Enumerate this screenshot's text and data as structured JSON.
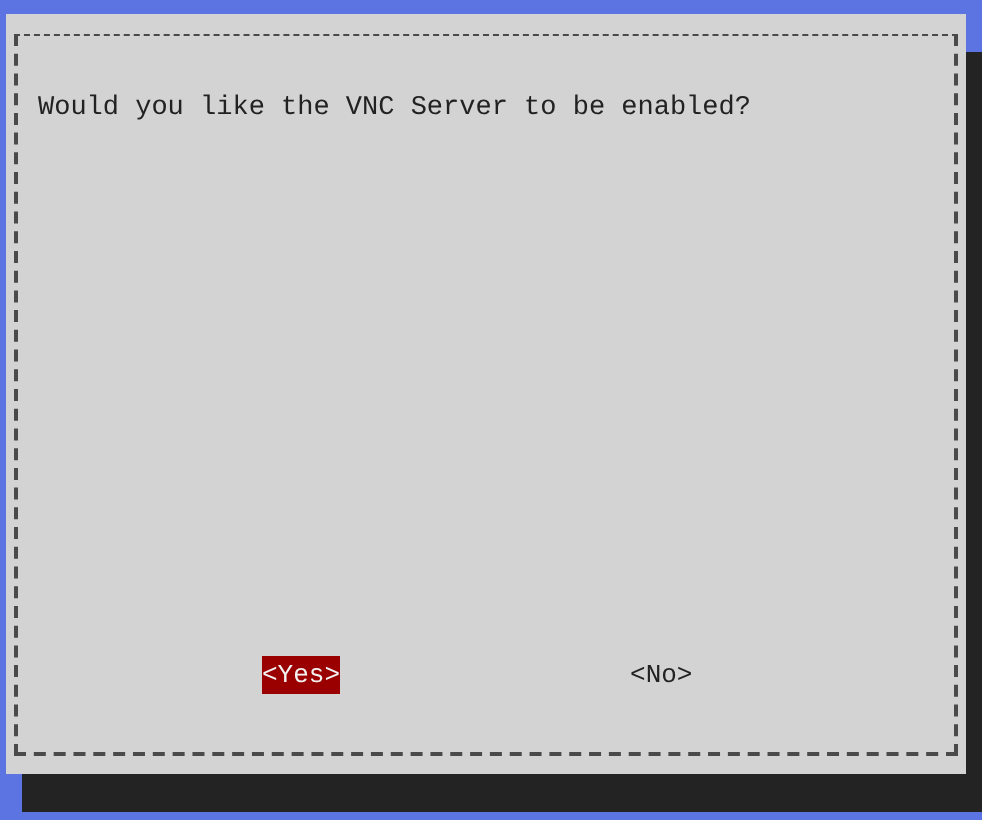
{
  "dialog": {
    "message": "Would you like the VNC Server to be enabled?"
  },
  "buttons": [
    {
      "label": "<Yes>",
      "selected": true
    },
    {
      "label": "<No>",
      "selected": false
    }
  ]
}
